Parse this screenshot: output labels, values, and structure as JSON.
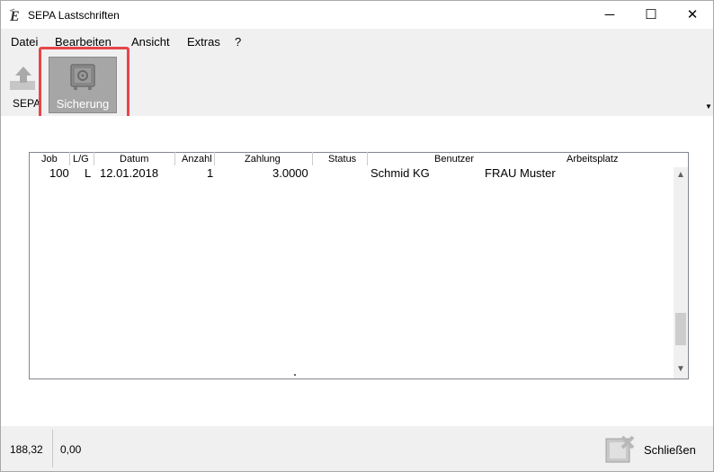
{
  "window": {
    "title": "SEPA Lastschriften",
    "controls": {
      "minimize": "─",
      "maximize": "☐",
      "close": "✕"
    }
  },
  "menu": [
    "Datei",
    "Bearbeiten",
    "Ansicht",
    "Extras",
    "?"
  ],
  "ribbon": {
    "sepa_label": "SEPA",
    "sicherung_label": "Sicherung",
    "highlight_color": "#e8454a"
  },
  "table": {
    "columns": [
      "Job",
      "L/G",
      "Datum",
      "Anzahl",
      "Zahlung",
      "Status",
      "Benutzer",
      "Arbeitsplatz"
    ],
    "rows": [
      [
        "100",
        "L",
        "12.01.2018",
        "1",
        "3.0000",
        "",
        "Schmid KG",
        "FRAU Muster"
      ]
    ]
  },
  "status": {
    "left_value": "188,32",
    "mid_value": "0,00",
    "close_label": "Schließen"
  }
}
